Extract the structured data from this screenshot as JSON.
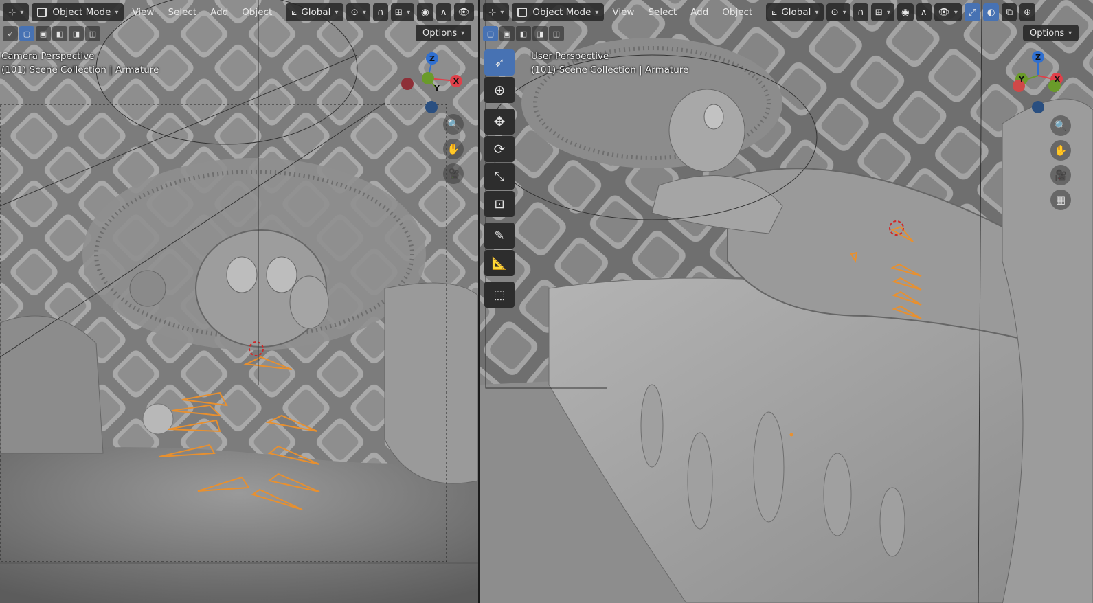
{
  "left_viewport": {
    "header": {
      "editor_type_icon": "3d-viewport-icon",
      "mode_label": "Object Mode",
      "menus": [
        "View",
        "Select",
        "Add",
        "Object"
      ],
      "orientation_label": "Global"
    },
    "options_label": "Options",
    "overlay": {
      "perspective_label": "Camera Perspective",
      "collection_label": "(101) Scene Collection | Armature"
    },
    "gizmo_axes": {
      "x": "X",
      "y": "Y",
      "z": "Z"
    }
  },
  "right_viewport": {
    "header": {
      "editor_type_icon": "3d-viewport-icon",
      "mode_label": "Object Mode",
      "menus": [
        "View",
        "Select",
        "Add",
        "Object"
      ],
      "orientation_label": "Global"
    },
    "options_label": "Options",
    "overlay": {
      "perspective_label": "User Perspective",
      "collection_label": "(101) Scene Collection | Armature"
    },
    "gizmo_axes": {
      "x": "X",
      "y": "Y",
      "z": "Z"
    },
    "toolbar": [
      "select-box-tool",
      "cursor-tool",
      "move-tool",
      "rotate-tool",
      "scale-tool",
      "transform-tool",
      "annotate-tool",
      "measure-tool",
      "add-cube-tool"
    ]
  },
  "colors": {
    "header_bg": "#282828",
    "active_blue": "#4772b3",
    "axis_x": "#e0404a",
    "axis_y": "#6a9b2a",
    "axis_z": "#2f6fd0",
    "bone_orange": "#e8902f",
    "viewport_gray": "#8a8a8a"
  }
}
